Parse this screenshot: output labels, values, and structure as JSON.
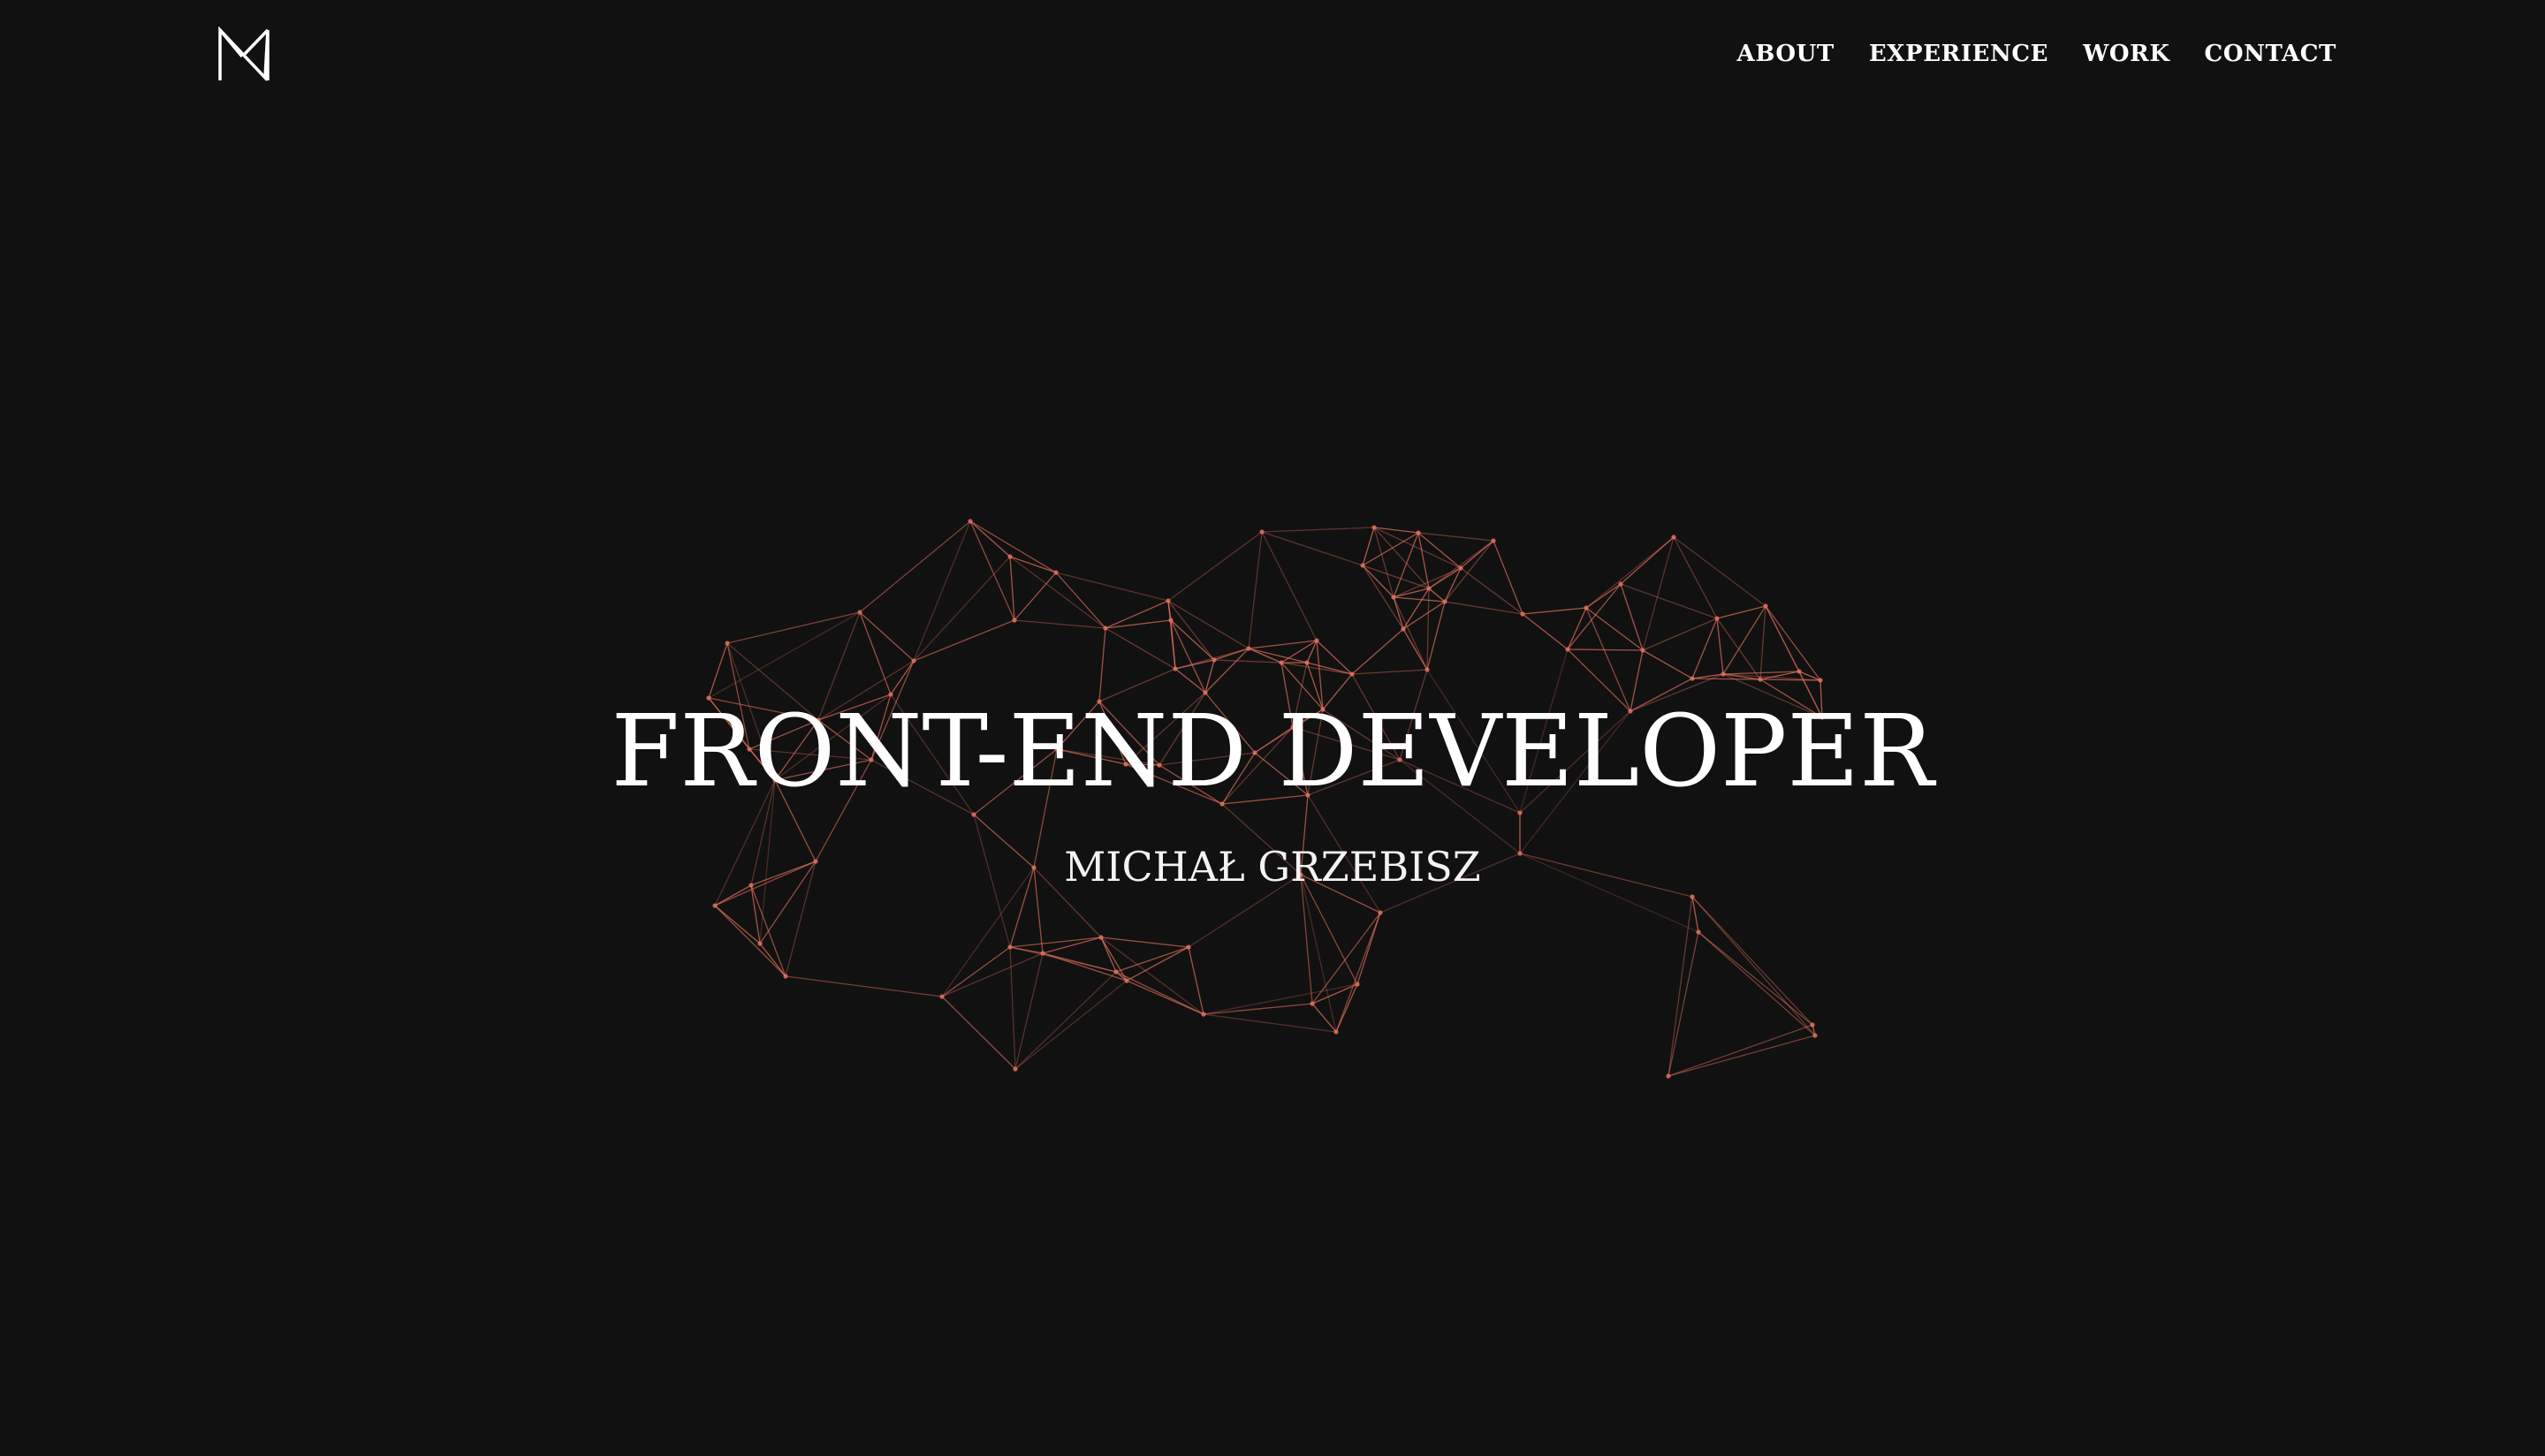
{
  "header": {
    "logo_label": "MN",
    "nav": [
      {
        "label": "ABOUT"
      },
      {
        "label": "EXPERIENCE"
      },
      {
        "label": "WORK"
      },
      {
        "label": "CONTACT"
      }
    ]
  },
  "hero": {
    "title": "FRONT-END DEVELOPER",
    "subtitle": "MICHAŁ GRZEBISZ"
  },
  "colors": {
    "background": "#111111",
    "text": "#ffffff",
    "network_accent": "#e0715f"
  }
}
